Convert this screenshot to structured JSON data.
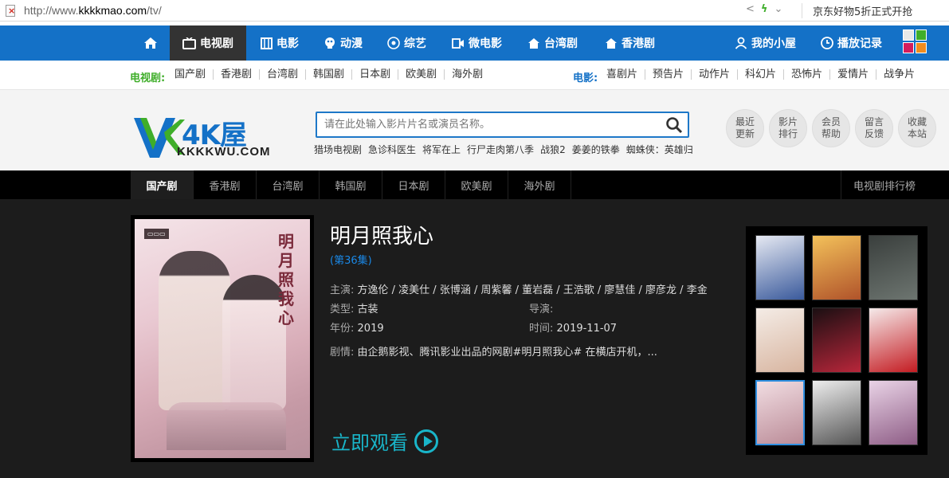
{
  "browser": {
    "url_prefix": "http://www.",
    "url_domain": "kkkkmao.com",
    "url_path": "/tv/",
    "promo": "京东好物5折正式开抢"
  },
  "mainnav": {
    "items": [
      {
        "label": "电视剧",
        "icon": "tv-icon",
        "active": true
      },
      {
        "label": "电影",
        "icon": "film-icon"
      },
      {
        "label": "动漫",
        "icon": "anime-icon"
      },
      {
        "label": "综艺",
        "icon": "variety-icon"
      },
      {
        "label": "微电影",
        "icon": "camera-icon"
      },
      {
        "label": "台湾剧",
        "icon": "home-icon"
      },
      {
        "label": "香港剧",
        "icon": "home-icon"
      }
    ],
    "home_icon": "home-icon",
    "my_house": "我的小屋",
    "history": "播放记录",
    "colors": [
      "#e8e8e8",
      "#3fae2a",
      "#d41c5c",
      "#f28c1e"
    ]
  },
  "subnav": {
    "tv_label": "电视剧:",
    "tv_links": [
      "国产剧",
      "香港剧",
      "台湾剧",
      "韩国剧",
      "日本剧",
      "欧美剧",
      "海外剧"
    ],
    "movie_label": "电影:",
    "movie_links": [
      "喜剧片",
      "预告片",
      "动作片",
      "科幻片",
      "恐怖片",
      "爱情片",
      "战争片"
    ],
    "tv_label_color": "#3fae2a",
    "movie_label_color": "#1471c7"
  },
  "header": {
    "logo_main": "4K屋",
    "logo_sub": "KKKKWU.COM",
    "search_placeholder": "请在此处输入影片片名或演员名称。",
    "hot_searches": [
      "猎场电视剧",
      "急诊科医生",
      "将军在上",
      "行尸走肉第八季",
      "战狼2",
      "姜姜的铁拳",
      "蜘蛛侠：英雄归"
    ],
    "quick_links": [
      [
        "最近",
        "更新"
      ],
      [
        "影片",
        "排行"
      ],
      [
        "会员",
        "帮助"
      ],
      [
        "留言",
        "反馈"
      ],
      [
        "收藏",
        "本站"
      ]
    ]
  },
  "tabs": {
    "items": [
      "国产剧",
      "香港剧",
      "台湾剧",
      "韩国剧",
      "日本剧",
      "欧美剧",
      "海外剧"
    ],
    "active": 0,
    "ranking": "电视剧排行榜"
  },
  "feature": {
    "poster_title": "明月照我心",
    "title": "明月照我心",
    "episode": "(第36集)",
    "cast_label": "主演:",
    "cast": "方逸伦 / 凌美仕 / 张博涵 / 周紫馨 / 董岩磊 / 王浩歌 / 廖慧佳 / 廖彦龙 / 李金",
    "type_label": "类型:",
    "type": "古装",
    "director_label": "导演:",
    "director": "",
    "year_label": "年份:",
    "year": "2019",
    "time_label": "时间:",
    "time": "2019-11-07",
    "plot_label": "剧情:",
    "plot": "由企鹅影视、腾讯影业出品的网剧#明月照我心# 在横店开机，...",
    "watch": "立即观看"
  },
  "sidebar": {
    "thumbs": [
      {
        "c1": "#e6e9f2",
        "c2": "#3a5a9c"
      },
      {
        "c1": "#f3c15a",
        "c2": "#b0532a"
      },
      {
        "c1": "#3a3f3d",
        "c2": "#6d7570"
      },
      {
        "c1": "#f4ece6",
        "c2": "#d8b5a0"
      },
      {
        "c1": "#1a0f12",
        "c2": "#b8263a"
      },
      {
        "c1": "#f5eaea",
        "c2": "#c41c22"
      },
      {
        "c1": "#f1dde2",
        "c2": "#bb8c98",
        "active": true
      },
      {
        "c1": "#ededed",
        "c2": "#555555"
      },
      {
        "c1": "#e9d3e6",
        "c2": "#8e5d86"
      }
    ]
  }
}
